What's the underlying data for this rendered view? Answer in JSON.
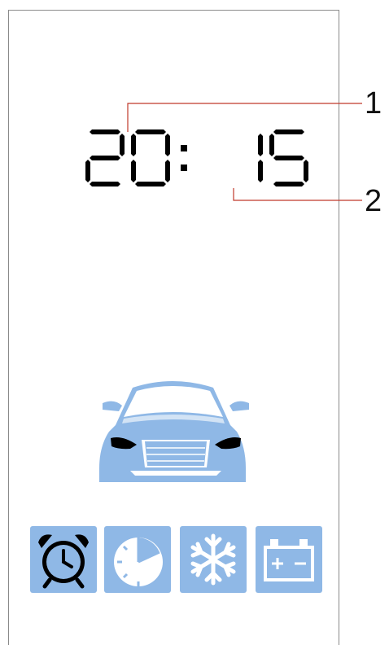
{
  "display": {
    "time": "20: 15"
  },
  "callouts": [
    {
      "id": "1",
      "target": "hour-digits"
    },
    {
      "id": "2",
      "target": "minute-digits"
    }
  ],
  "car": {
    "icon": "car-front-icon"
  },
  "status_icons": [
    {
      "icon": "alarm-clock-icon",
      "active": true
    },
    {
      "icon": "timer-icon",
      "active": false
    },
    {
      "icon": "snowflake-icon",
      "active": false
    },
    {
      "icon": "battery-icon",
      "active": false
    }
  ],
  "colors": {
    "accent": "#8fb8e6",
    "callout_line": "#c0392b",
    "segment": "#000000",
    "frame": "#8a8a8a"
  }
}
